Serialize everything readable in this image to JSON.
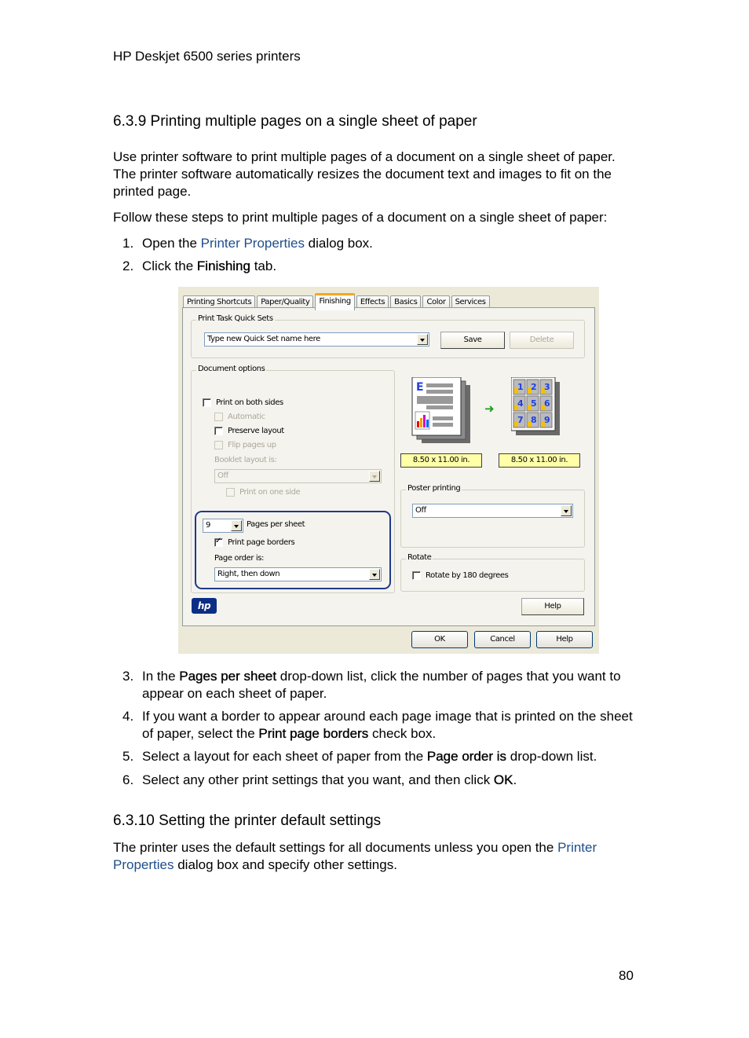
{
  "header": {
    "running_title": "HP Deskjet 6500 series printers"
  },
  "section_639": {
    "heading": "6.3.9  Printing multiple pages on a single sheet of paper",
    "intro": "Use printer software to print multiple pages of a document on a single sheet of paper. The printer software automatically resizes the document text and images to fit on the printed page.",
    "lead": "Follow these steps to print multiple pages of a document on a single sheet of paper:",
    "steps_before": [
      {
        "num": "1.",
        "pre": "Open the ",
        "link": "Printer Properties",
        "post": " dialog box."
      },
      {
        "num": "2.",
        "pre": "Click the ",
        "bold": "Finishing",
        "post": " tab."
      }
    ],
    "steps_after": [
      {
        "num": "3.",
        "pre": "In the ",
        "bold": "Pages per sheet",
        "post": " drop-down list, click the number of pages that you want to appear on each sheet of paper."
      },
      {
        "num": "4.",
        "pre": "If you want a border to appear around each page image that is printed on the sheet of paper, select the ",
        "bold": "Print page borders",
        "post": " check box."
      },
      {
        "num": "5.",
        "pre": "Select a layout for each sheet of paper from the ",
        "bold": "Page order is",
        "post": " drop-down list."
      },
      {
        "num": "6.",
        "pre": "Select any other print settings that you want, and then click ",
        "bold": "OK",
        "post": "."
      }
    ]
  },
  "dialog": {
    "tabs": [
      {
        "label": "Printing Shortcuts",
        "active": false
      },
      {
        "label": "Paper/Quality",
        "active": false
      },
      {
        "label": "Finishing",
        "active": true
      },
      {
        "label": "Effects",
        "active": false
      },
      {
        "label": "Basics",
        "active": false
      },
      {
        "label": "Color",
        "active": false
      },
      {
        "label": "Services",
        "active": false
      }
    ],
    "quick_sets": {
      "group_label": "Print Task Quick Sets",
      "combo_value": "Type new Quick Set name here",
      "save_label": "Save",
      "delete_label": "Delete"
    },
    "document_options": {
      "group_label": "Document options",
      "print_both_sides": "Print on both sides",
      "automatic": "Automatic",
      "preserve_layout": "Preserve layout",
      "flip_pages_up": "Flip pages up",
      "booklet_label": "Booklet layout is:",
      "booklet_value": "Off",
      "print_one_side": "Print on one side",
      "pages_per_sheet_value": "9",
      "pages_per_sheet_label": "Pages per sheet",
      "print_page_borders": "Print page borders",
      "print_page_borders_checked": true,
      "page_order_label": "Page order is:",
      "page_order_value": "Right, then down"
    },
    "preview": {
      "source_size": "8.50 x 11.00 in.",
      "output_size": "8.50 x 11.00 in.",
      "page_numbers": [
        "1",
        "2",
        "3",
        "4",
        "5",
        "6",
        "7",
        "8",
        "9"
      ]
    },
    "poster": {
      "group_label": "Poster printing",
      "value": "Off"
    },
    "rotate": {
      "group_label": "Rotate",
      "checkbox_label": "Rotate by 180 degrees"
    },
    "hp_logo": "hp",
    "panel_help": "Help",
    "ok": "OK",
    "cancel": "Cancel",
    "help": "Help"
  },
  "section_6310": {
    "heading": "6.3.10  Setting the printer default settings",
    "text_pre": "The printer uses the default settings for all documents unless you open the ",
    "link": "Printer Properties",
    "text_post": " dialog box and specify other settings."
  },
  "footer": {
    "page_number": "80"
  }
}
